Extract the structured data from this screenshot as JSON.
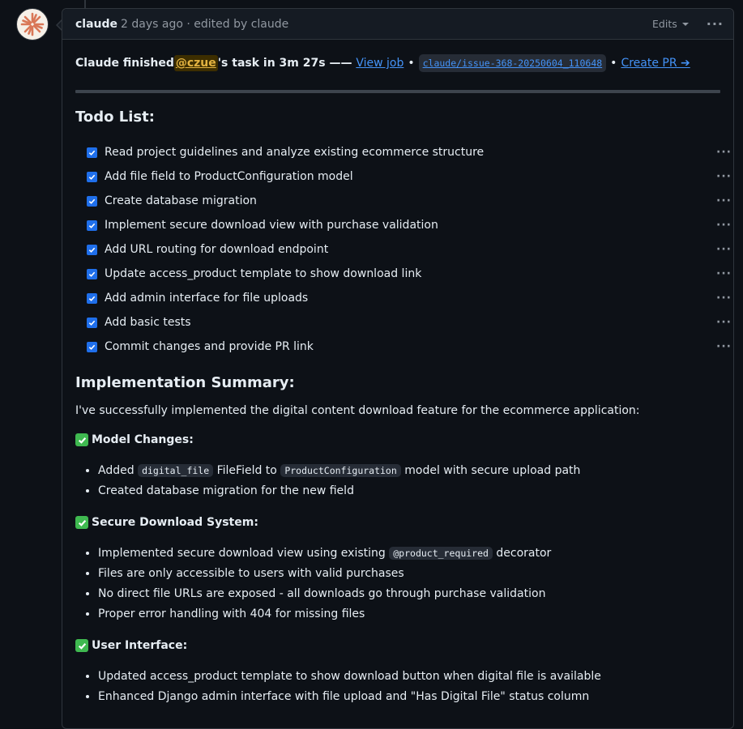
{
  "header": {
    "author": "claude",
    "meta": "2 days ago · edited by claude",
    "edits_label": "Edits"
  },
  "status": {
    "prefix": "Claude finished ",
    "mention": "@czue",
    "suffix": "'s task in 3m 27s —— ",
    "view_job": "View job",
    "branch": "claude/issue-368-20250604_110648",
    "create_pr": "Create PR ➔",
    "separator": "•"
  },
  "todo": {
    "title": "Todo List:",
    "items": [
      "Read project guidelines and analyze existing ecommerce structure",
      "Add file field to ProductConfiguration model",
      "Create database migration",
      "Implement secure download view with purchase validation",
      "Add URL routing for download endpoint",
      "Update access_product template to show download link",
      "Add admin interface for file uploads",
      "Add basic tests",
      "Commit changes and provide PR link"
    ]
  },
  "summary": {
    "title": "Implementation Summary:",
    "intro": "I've successfully implemented the digital content download feature for the ecommerce application:",
    "model": {
      "title": "Model Changes:",
      "b1_pre": "Added ",
      "b1_code1": "digital_file",
      "b1_mid": " FileField to ",
      "b1_code2": "ProductConfiguration",
      "b1_post": " model with secure upload path",
      "b2": "Created database migration for the new field"
    },
    "download": {
      "title": "Secure Download System:",
      "b1_pre": "Implemented secure download view using existing ",
      "b1_code": "@product_required",
      "b1_post": " decorator",
      "b2": "Files are only accessible to users with valid purchases",
      "b3": "No direct file URLs are exposed - all downloads go through purchase validation",
      "b4": "Proper error handling with 404 for missing files"
    },
    "ui": {
      "title": "User Interface:",
      "b1": "Updated access_product template to show download button when digital file is available",
      "b2": "Enhanced Django admin interface with file upload and \"Has Digital File\" status column"
    }
  },
  "colors": {
    "link": "#4493f8",
    "checkbox": "#1f6feb",
    "check_emoji": "#3fb950",
    "mention": "#e3b341"
  }
}
